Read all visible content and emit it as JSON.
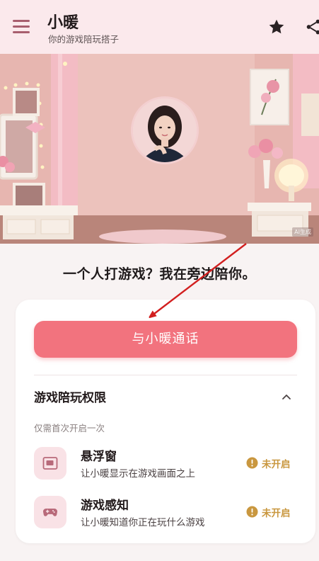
{
  "header": {
    "title": "小暖",
    "subtitle": "你的游戏陪玩搭子",
    "menu_icon": "hamburger-menu-icon",
    "star_icon": "star-icon",
    "share_icon": "share-icon"
  },
  "hero": {
    "watermark": "AI生成"
  },
  "tagline": "一个人打游戏？我在旁边陪你。",
  "call_button": "与小暖通话",
  "permissions": {
    "title": "游戏陪玩权限",
    "note": "仅需首次开启一次",
    "items": [
      {
        "name": "悬浮窗",
        "description": "让小暖显示在游戏画面之上",
        "status": "未开启",
        "icon": "floating-window-icon"
      },
      {
        "name": "游戏感知",
        "description": "让小暖知道你正在玩什么游戏",
        "status": "未开启",
        "icon": "gamepad-icon"
      }
    ]
  },
  "colors": {
    "accent": "#f2737e",
    "header_bg": "#fbe9ec",
    "status": "#c9973f",
    "annotation_arrow": "#d21f1f"
  }
}
